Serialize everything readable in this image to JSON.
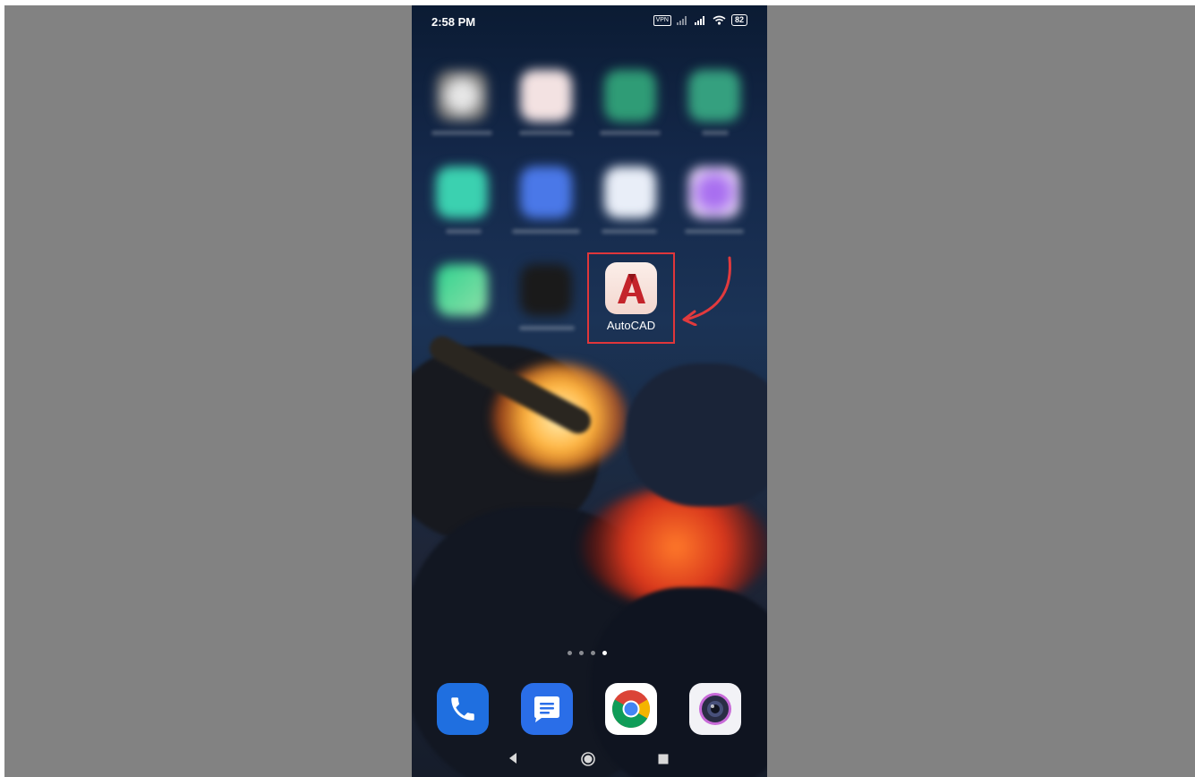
{
  "status_bar": {
    "time": "2:58 PM",
    "vpn": "VPN",
    "battery": "82"
  },
  "home": {
    "highlighted_app": {
      "label": "AutoCAD",
      "icon": "autocad-icon"
    },
    "page_indicator": {
      "pages": 4,
      "active_page": 4
    }
  },
  "dock": [
    {
      "name": "phone-app",
      "icon": "phone-icon",
      "color": "#1f6fe0"
    },
    {
      "name": "messages-app",
      "icon": "message-icon",
      "color": "#2a6ee8"
    },
    {
      "name": "chrome-app",
      "icon": "chrome-icon",
      "color": "#ffffff"
    },
    {
      "name": "camera-app",
      "icon": "camera-icon",
      "color": "#f2f2f6"
    }
  ],
  "nav_bar": {
    "back": "back-icon",
    "home": "home-icon",
    "recents": "recents-icon"
  },
  "colors": {
    "highlight_box": "#e0363a",
    "backdrop": "#828282"
  }
}
